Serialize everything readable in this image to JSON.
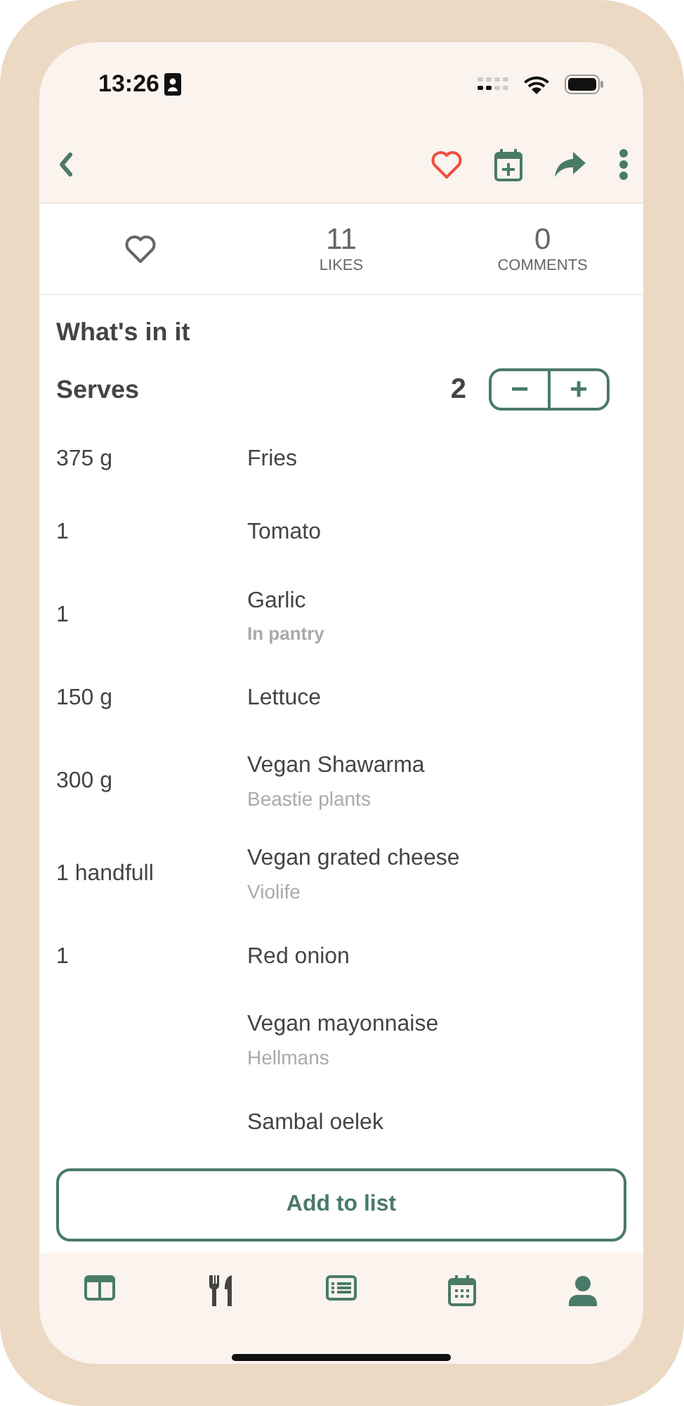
{
  "status_bar": {
    "time": "13:26"
  },
  "header": {
    "favorite": false
  },
  "stats": [
    {
      "value": "11",
      "label": "LIKES"
    },
    {
      "value": "0",
      "label": "COMMENTS"
    }
  ],
  "section_title": "What's in it",
  "serves": {
    "label": "Serves",
    "value": "2",
    "minus": "−",
    "plus": "+"
  },
  "ingredients": [
    {
      "amount": "375 g",
      "name": "Fries"
    },
    {
      "amount": "1",
      "name": "Tomato"
    },
    {
      "amount": "1",
      "name": "Garlic",
      "note": "In pantry",
      "kind": "pantry"
    },
    {
      "amount": "150 g",
      "name": "Lettuce"
    },
    {
      "amount": "300 g",
      "name": "Vegan Shawarma",
      "note": "Beastie plants",
      "kind": "brand"
    },
    {
      "amount": "1 handfull",
      "name": "Vegan grated cheese",
      "note": "Violife",
      "kind": "brand"
    },
    {
      "amount": "1",
      "name": "Red onion"
    },
    {
      "name": "Vegan mayonnaise",
      "note": "Hellmans",
      "kind": "brand"
    },
    {
      "name": "Sambal oelek"
    }
  ],
  "add_button": "Add to list",
  "tabs": [
    {
      "selected": false
    },
    {
      "selected": true
    },
    {
      "selected": false
    },
    {
      "selected": false
    },
    {
      "selected": false
    }
  ]
}
